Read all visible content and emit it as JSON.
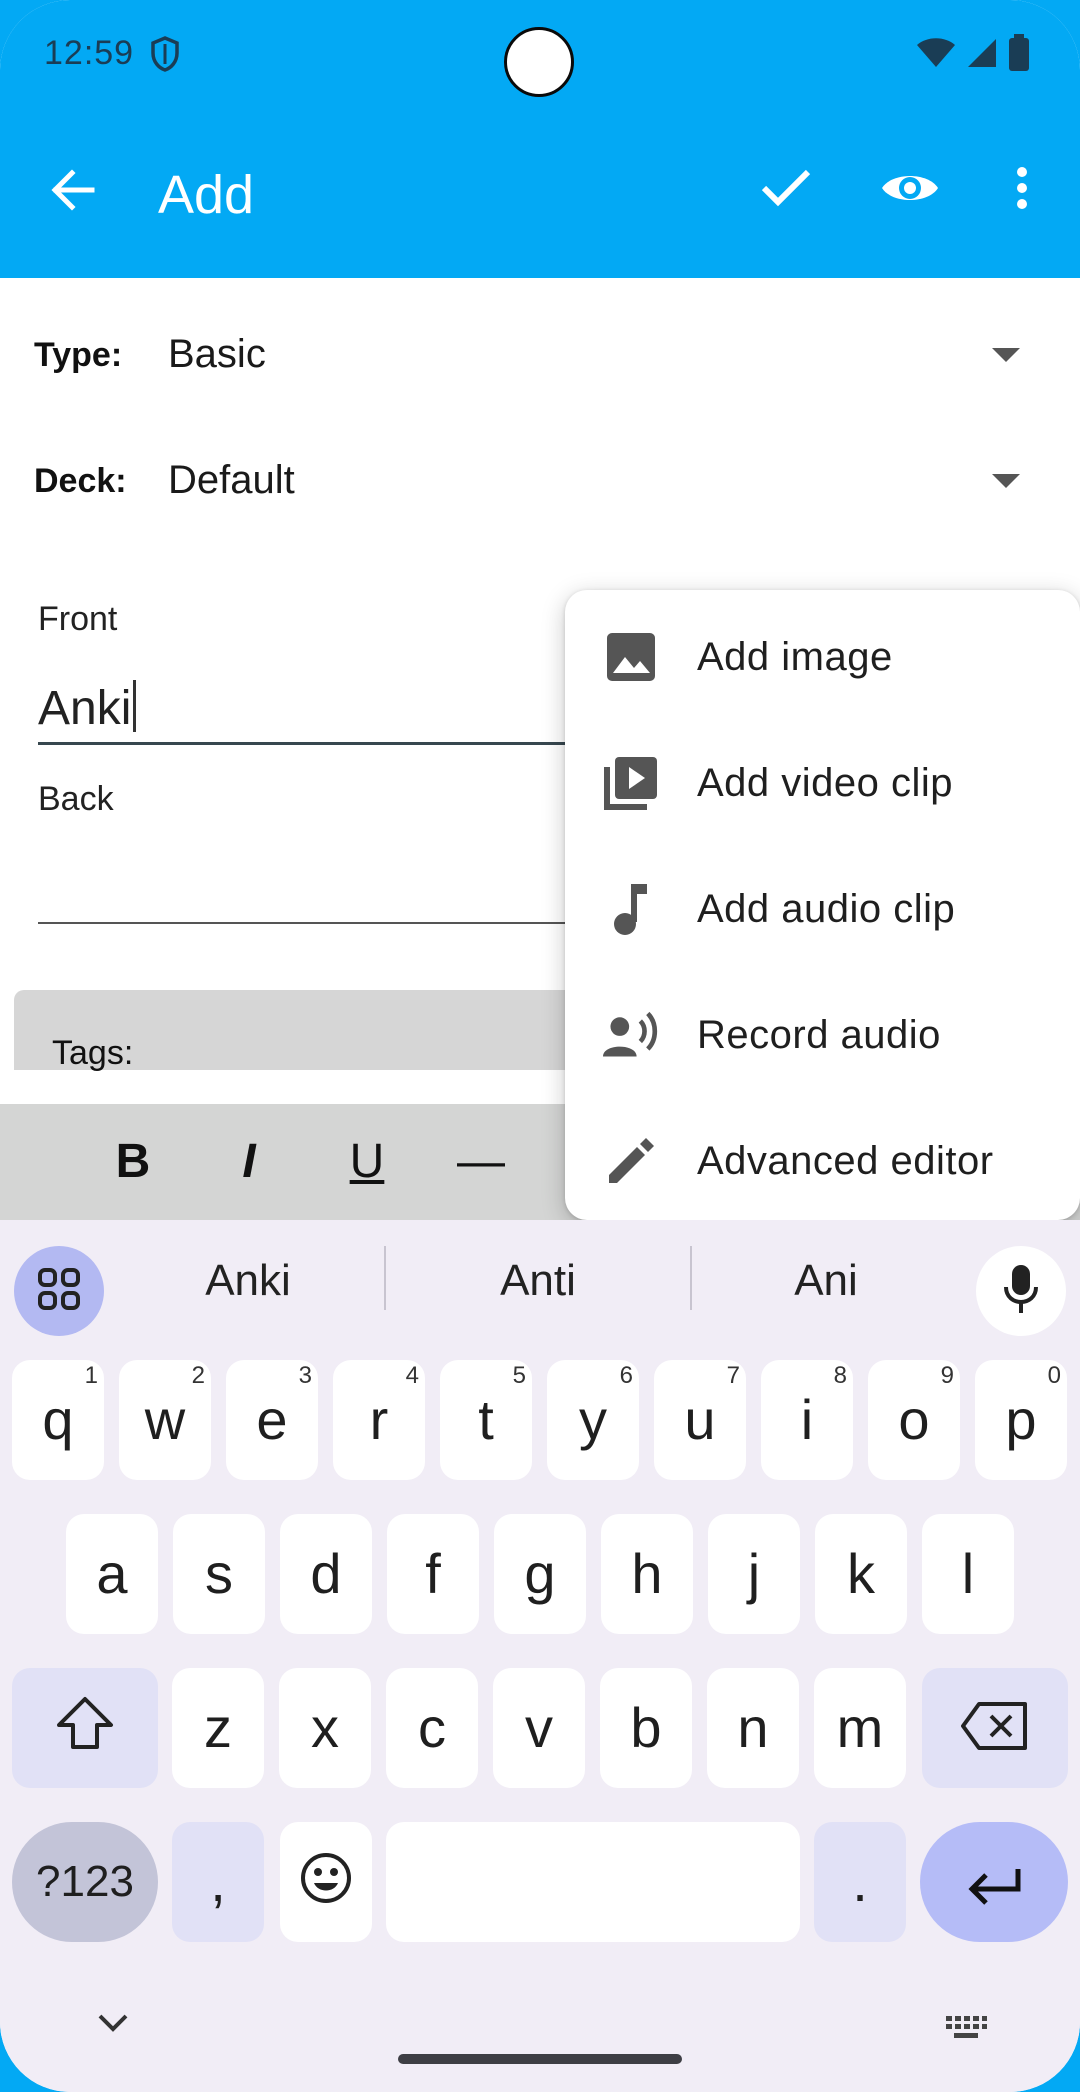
{
  "status_bar": {
    "time": "12:59"
  },
  "app_bar": {
    "title": "Add"
  },
  "form": {
    "type_label": "Type:",
    "type_value": "Basic",
    "deck_label": "Deck:",
    "deck_value": "Default",
    "front_label": "Front",
    "front_value": "Anki",
    "back_label": "Back",
    "back_value": "",
    "tags_label": "Tags:"
  },
  "format_toolbar": {
    "bold": "B",
    "italic": "I",
    "underline": "U",
    "rule": "—"
  },
  "popup_menu": {
    "items": [
      {
        "label": "Add image",
        "icon": "image-icon"
      },
      {
        "label": "Add video clip",
        "icon": "video-library-icon"
      },
      {
        "label": "Add audio clip",
        "icon": "music-note-icon"
      },
      {
        "label": "Record audio",
        "icon": "record-voice-icon"
      },
      {
        "label": "Advanced editor",
        "icon": "pencil-icon"
      }
    ]
  },
  "keyboard": {
    "suggestions": [
      "Anki",
      "Anti",
      "Ani"
    ],
    "row1": [
      {
        "k": "q",
        "h": "1"
      },
      {
        "k": "w",
        "h": "2"
      },
      {
        "k": "e",
        "h": "3"
      },
      {
        "k": "r",
        "h": "4"
      },
      {
        "k": "t",
        "h": "5"
      },
      {
        "k": "y",
        "h": "6"
      },
      {
        "k": "u",
        "h": "7"
      },
      {
        "k": "i",
        "h": "8"
      },
      {
        "k": "o",
        "h": "9"
      },
      {
        "k": "p",
        "h": "0"
      }
    ],
    "row2": [
      "a",
      "s",
      "d",
      "f",
      "g",
      "h",
      "j",
      "k",
      "l"
    ],
    "row3": [
      "z",
      "x",
      "c",
      "v",
      "b",
      "n",
      "m"
    ],
    "symbols_key": "?123",
    "comma_key": ",",
    "period_key": "."
  },
  "colors": {
    "app_bar": "#03a9f4",
    "keyboard_bg": "#f1edf6",
    "accent_key": "#b5bcf7"
  }
}
